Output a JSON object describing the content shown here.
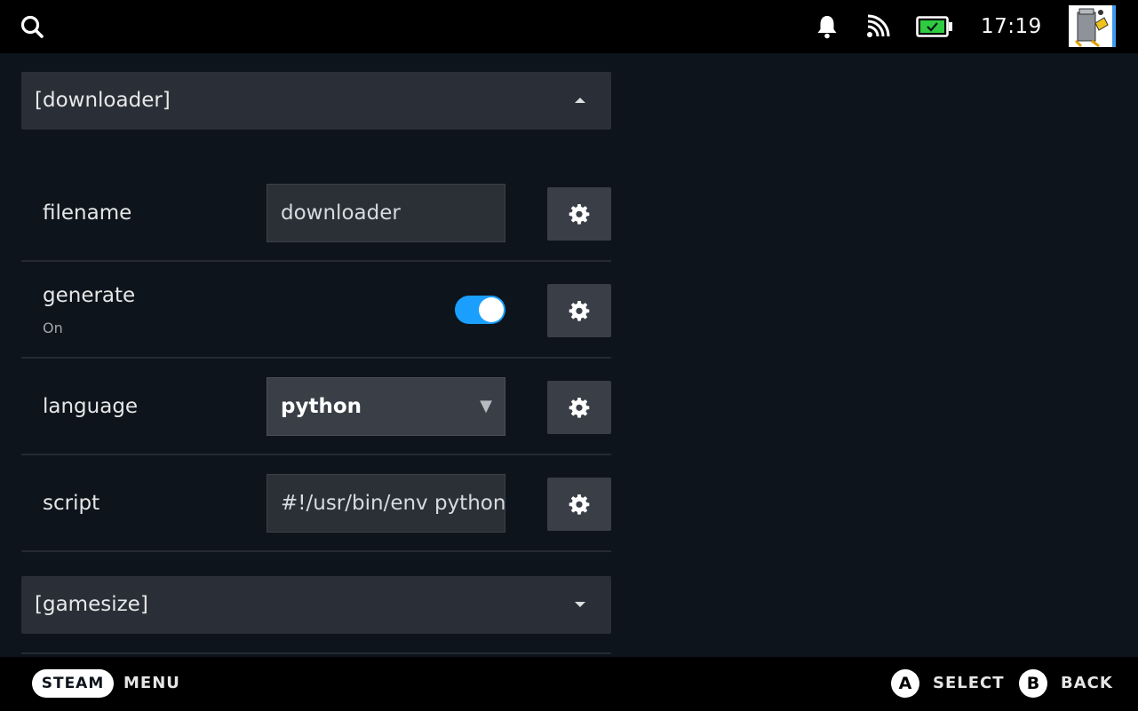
{
  "status_bar": {
    "clock": "17:19",
    "icons": [
      "search-icon",
      "bell-icon",
      "cast-icon",
      "battery-icon",
      "avatar"
    ],
    "battery_color": "#2ecc40"
  },
  "sections": {
    "downloader": {
      "label": "[downloader]",
      "expanded": true
    },
    "gamesize": {
      "label": "[gamesize]",
      "expanded": false
    }
  },
  "fields": {
    "filename": {
      "label": "filename",
      "value": "downloader"
    },
    "generate": {
      "label": "generate",
      "state_text": "On",
      "enabled": true
    },
    "language": {
      "label": "language",
      "selected": "python"
    },
    "script": {
      "label": "script",
      "value": "#!/usr/bin/env python"
    }
  },
  "footer": {
    "steam_label": "STEAM",
    "menu_label": "MENU",
    "select_key": "A",
    "select_label": "SELECT",
    "back_key": "B",
    "back_label": "BACK"
  },
  "colors": {
    "accent": "#1a9fff",
    "panel": "#2a2f37",
    "background": "#0e141b"
  }
}
